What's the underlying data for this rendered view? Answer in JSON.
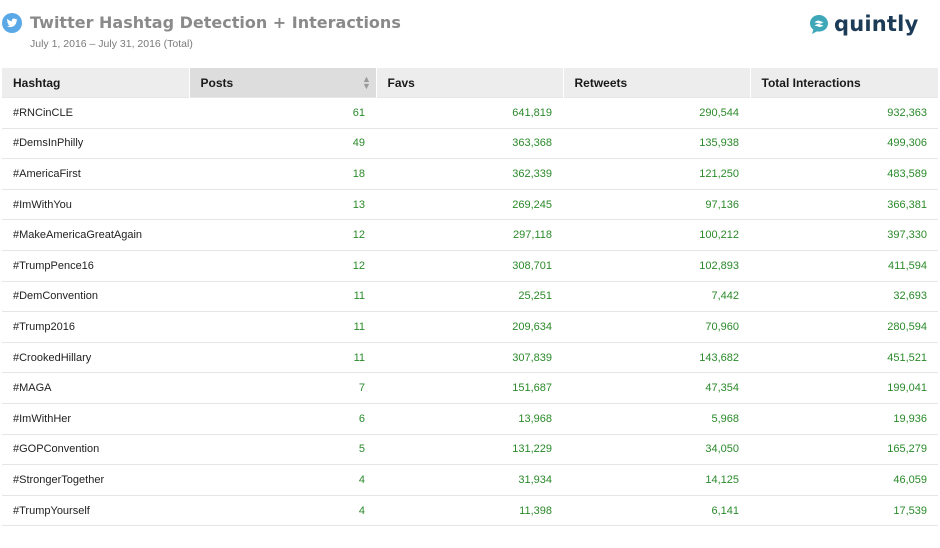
{
  "header": {
    "title": "Twitter Hashtag Detection + Interactions",
    "subtitle": "July 1, 2016 – July 31, 2016 (Total)",
    "logo_text": "quintly",
    "twitter_icon": "twitter-bird-icon",
    "logo_icon": "quintly-logo-icon"
  },
  "colors": {
    "accent_blue": "#5aa9e6",
    "number_green": "#2a8a2a",
    "logo_navy": "#1c3b57",
    "logo_teal": "#3ea7b8"
  },
  "table": {
    "columns": [
      "Hashtag",
      "Posts",
      "Favs",
      "Retweets",
      "Total Interactions"
    ],
    "sorted_column": "Posts",
    "rows": [
      [
        "#RNCinCLE",
        "61",
        "641,819",
        "290,544",
        "932,363"
      ],
      [
        "#DemsInPhilly",
        "49",
        "363,368",
        "135,938",
        "499,306"
      ],
      [
        "#AmericaFirst",
        "18",
        "362,339",
        "121,250",
        "483,589"
      ],
      [
        "#ImWithYou",
        "13",
        "269,245",
        "97,136",
        "366,381"
      ],
      [
        "#MakeAmericaGreatAgain",
        "12",
        "297,118",
        "100,212",
        "397,330"
      ],
      [
        "#TrumpPence16",
        "12",
        "308,701",
        "102,893",
        "411,594"
      ],
      [
        "#DemConvention",
        "11",
        "25,251",
        "7,442",
        "32,693"
      ],
      [
        "#Trump2016",
        "11",
        "209,634",
        "70,960",
        "280,594"
      ],
      [
        "#CrookedHillary",
        "11",
        "307,839",
        "143,682",
        "451,521"
      ],
      [
        "#MAGA",
        "7",
        "151,687",
        "47,354",
        "199,041"
      ],
      [
        "#ImWithHer",
        "6",
        "13,968",
        "5,968",
        "19,936"
      ],
      [
        "#GOPConvention",
        "5",
        "131,229",
        "34,050",
        "165,279"
      ],
      [
        "#StrongerTogether",
        "4",
        "31,934",
        "14,125",
        "46,059"
      ],
      [
        "#TrumpYourself",
        "4",
        "11,398",
        "6,141",
        "17,539"
      ]
    ]
  }
}
